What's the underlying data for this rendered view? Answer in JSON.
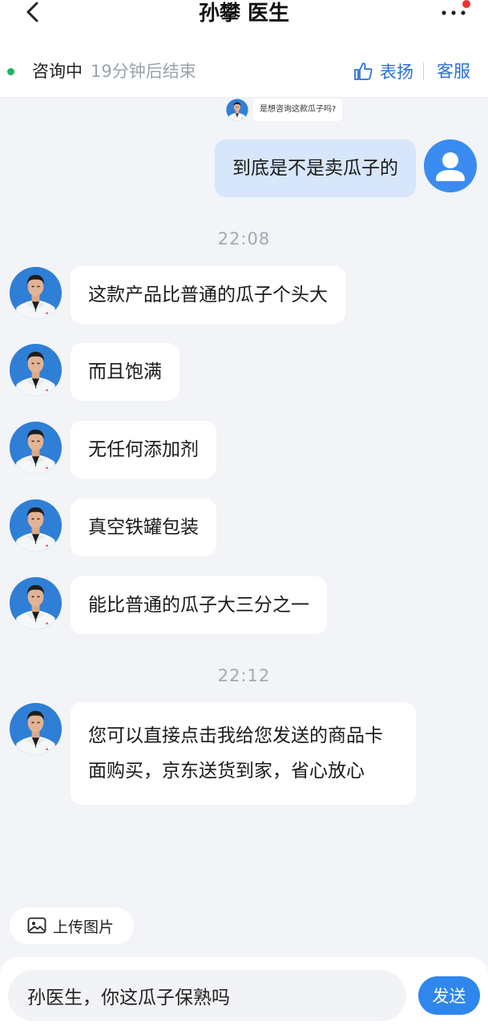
{
  "header": {
    "title": "孙攀 医生",
    "back_icon": "chevron-left-icon",
    "more_icon": "more-dots-icon"
  },
  "status": {
    "state": "咨询中",
    "remaining": "19分钟后结束",
    "praise_label": "表扬",
    "service_label": "客服",
    "dot_color": "#19b85b",
    "accent": "#2a6fd6"
  },
  "messages": {
    "doc_question": "是想咨询这款瓜子吗?",
    "user_msg": "到底是不是卖瓜子的",
    "time1": "22:08",
    "doc1": "这款产品比普通的瓜子个头大",
    "doc2": "而且饱满",
    "doc3": "无任何添加剂",
    "doc4": "真空铁罐包装",
    "doc5": "能比普通的瓜子大三分之一",
    "time2": "22:12",
    "doc6": "您可以直接点击我给您发送的商品卡面购买，京东送货到家，省心放心"
  },
  "upload": {
    "label": "上传图片",
    "icon": "image-upload-icon"
  },
  "composer": {
    "value": "孙医生，你这瓜子保熟吗",
    "send_label": "发送",
    "send_color": "#2f86ec"
  }
}
